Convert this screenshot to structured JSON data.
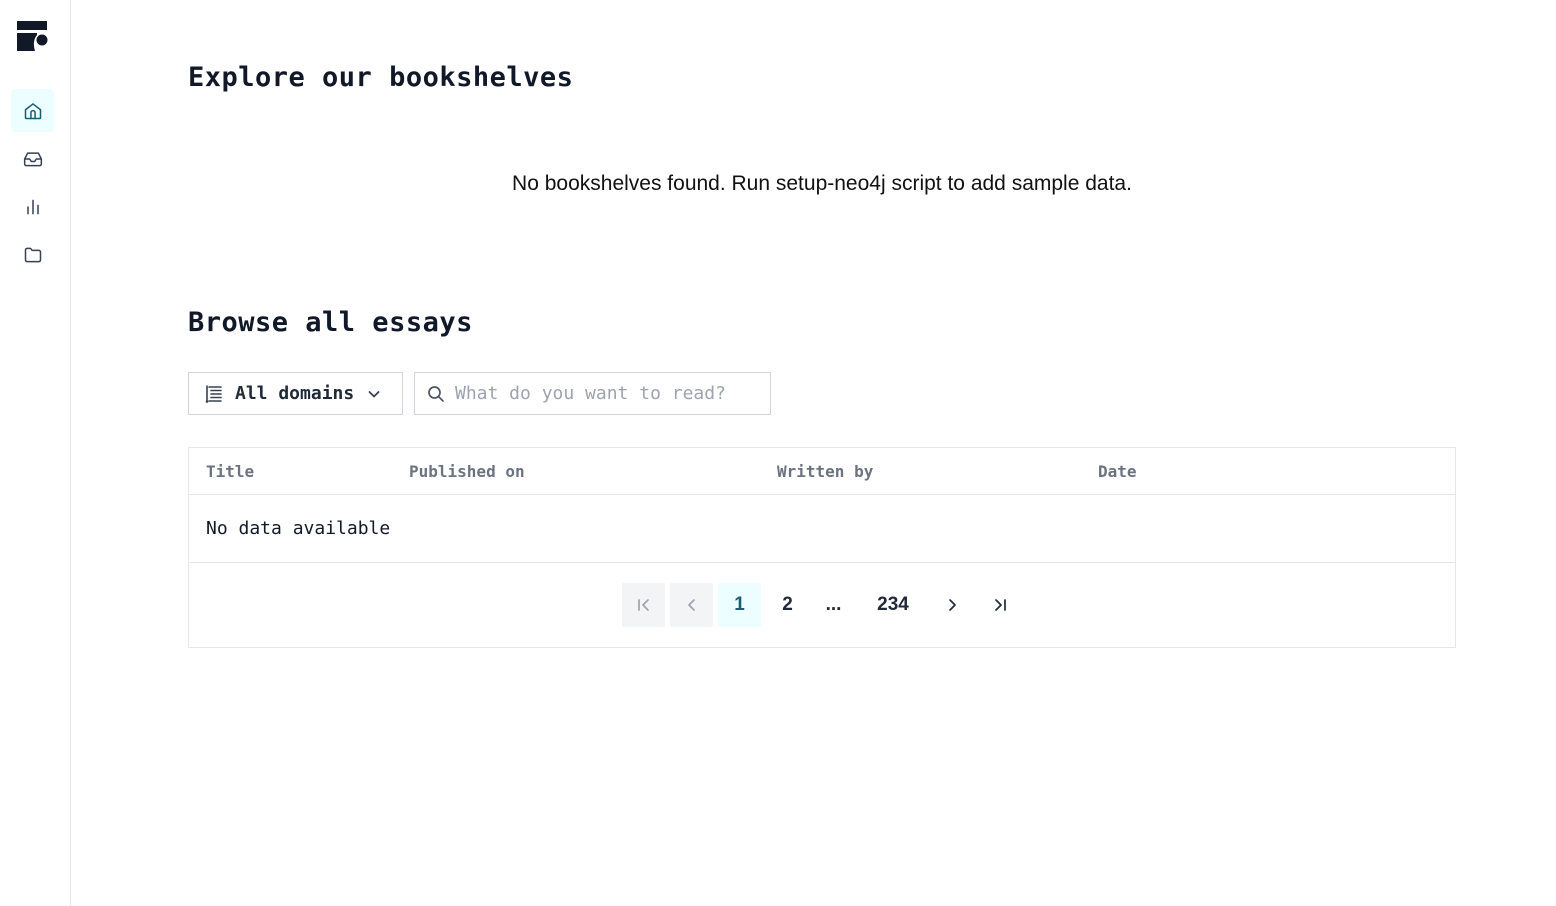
{
  "sidebar": {
    "items": [
      {
        "icon": "home-icon",
        "active": true
      },
      {
        "icon": "inbox-icon",
        "active": false
      },
      {
        "icon": "bar-chart-icon",
        "active": false
      },
      {
        "icon": "folder-icon",
        "active": false
      }
    ]
  },
  "bookshelves": {
    "title": "Explore our bookshelves",
    "empty_message": "No bookshelves found. Run setup-neo4j script to add sample data."
  },
  "essays": {
    "title": "Browse all essays",
    "domain_filter": {
      "selected": "All domains",
      "icon": "list-filter-icon"
    },
    "search": {
      "placeholder": "What do you want to read?",
      "value": ""
    },
    "table": {
      "columns": [
        "Title",
        "Published on",
        "Written by",
        "Date"
      ],
      "rows": [],
      "empty_message": "No data available"
    },
    "pagination": {
      "current": "1",
      "pages": [
        "1",
        "2",
        "...",
        "234"
      ],
      "first_disabled": true,
      "prev_disabled": true
    }
  },
  "colors": {
    "accent_bg": "#ecfeff",
    "accent_text": "#155e75",
    "border": "#e5e7eb"
  }
}
